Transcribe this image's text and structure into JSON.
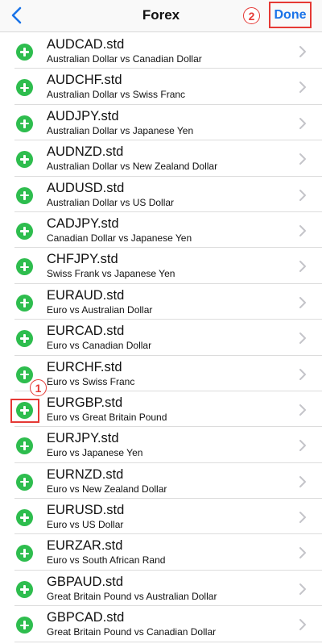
{
  "header": {
    "title": "Forex",
    "done_label": "Done",
    "step_done": "2"
  },
  "step_add": "1",
  "colors": {
    "accent": "#1a73e8",
    "add_green": "#2ebd4e",
    "annotation_red": "#e53935"
  },
  "symbols": [
    {
      "name": "AUDCAD.std",
      "desc": "Australian Dollar vs Canadian Dollar"
    },
    {
      "name": "AUDCHF.std",
      "desc": "Australian Dollar vs Swiss Franc"
    },
    {
      "name": "AUDJPY.std",
      "desc": "Australian Dollar vs Japanese Yen"
    },
    {
      "name": "AUDNZD.std",
      "desc": "Australian Dollar vs New Zealand Dollar"
    },
    {
      "name": "AUDUSD.std",
      "desc": "Australian Dollar vs US Dollar"
    },
    {
      "name": "CADJPY.std",
      "desc": "Canadian Dollar vs Japanese Yen"
    },
    {
      "name": "CHFJPY.std",
      "desc": "Swiss Frank vs Japanese Yen"
    },
    {
      "name": "EURAUD.std",
      "desc": "Euro vs Australian Dollar"
    },
    {
      "name": "EURCAD.std",
      "desc": "Euro vs Canadian Dollar"
    },
    {
      "name": "EURCHF.std",
      "desc": "Euro vs Swiss Franc"
    },
    {
      "name": "EURGBP.std",
      "desc": "Euro vs Great Britain Pound"
    },
    {
      "name": "EURJPY.std",
      "desc": "Euro vs Japanese Yen"
    },
    {
      "name": "EURNZD.std",
      "desc": "Euro vs New Zealand Dollar"
    },
    {
      "name": "EURUSD.std",
      "desc": "Euro vs US Dollar"
    },
    {
      "name": "EURZAR.std",
      "desc": "Euro vs South African Rand"
    },
    {
      "name": "GBPAUD.std",
      "desc": "Great Britain Pound vs Australian Dollar"
    },
    {
      "name": "GBPCAD.std",
      "desc": "Great Britain Pound vs Canadian Dollar"
    }
  ]
}
